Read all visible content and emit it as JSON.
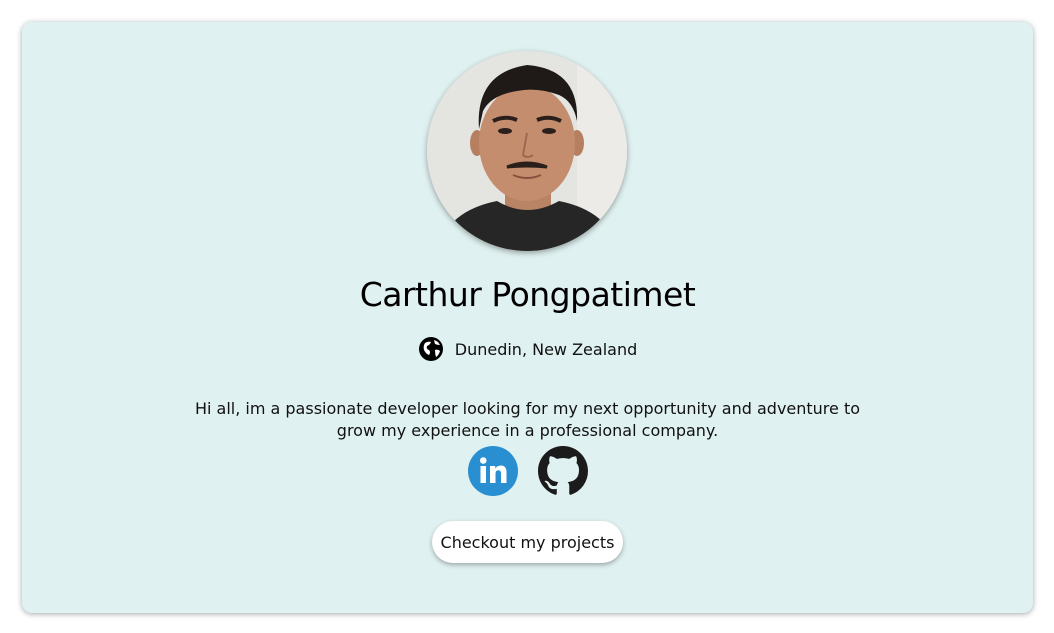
{
  "profile": {
    "name": "Carthur Pongpatimet",
    "location": "Dunedin, New Zealand",
    "bio": "Hi all, im a passionate developer looking for my next opportunity and adventure to grow my experience in a professional company.",
    "avatar_alt": "profile-photo"
  },
  "socials": [
    {
      "icon": "linkedin-icon",
      "color": "#2a8fd0"
    },
    {
      "icon": "github-icon",
      "color": "#1b1b1b"
    }
  ],
  "actions": {
    "projects_button": "Checkout my projects"
  },
  "colors": {
    "card_background": "#dff1f0",
    "button_background": "#ffffff"
  }
}
